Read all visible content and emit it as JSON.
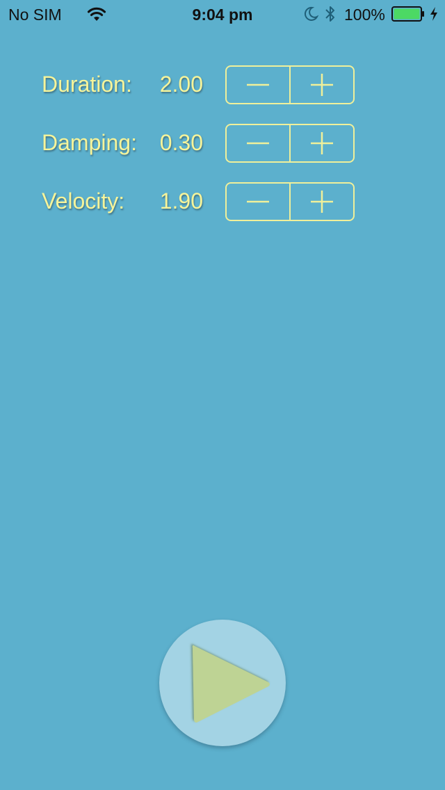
{
  "status_bar": {
    "carrier": "No SIM",
    "time": "9:04 pm",
    "battery_percent": "100%",
    "battery_color": "#4cd964",
    "icons": [
      "wifi-icon",
      "moon-icon",
      "bluetooth-icon",
      "battery-icon",
      "charging-bolt-icon"
    ]
  },
  "controls": [
    {
      "label": "Duration:",
      "value": "2.00",
      "decrement": "minus-icon",
      "increment": "plus-icon"
    },
    {
      "label": "Damping:",
      "value": "0.30",
      "decrement": "minus-icon",
      "increment": "plus-icon"
    },
    {
      "label": "Velocity:",
      "value": "1.90",
      "decrement": "minus-icon",
      "increment": "plus-icon"
    }
  ],
  "play_button": {
    "icon": "play-icon"
  },
  "colors": {
    "background": "#5cb0cd",
    "text": "#f6f49a",
    "stepper_tint": "#f0f09a",
    "play_circle": "#a3d3e4",
    "play_triangle": "#bed394"
  }
}
